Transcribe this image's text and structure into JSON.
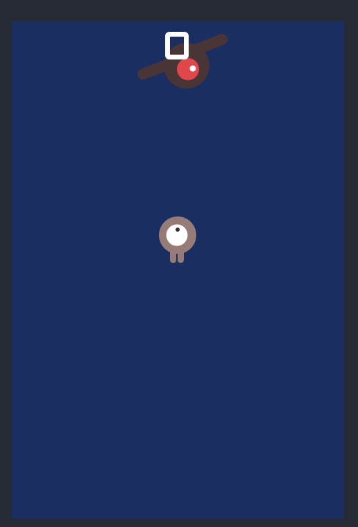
{
  "game": {
    "score": "0",
    "colors": {
      "frame": "#262a33",
      "field": "#1b2e61",
      "enemy_body": "#4a3536",
      "enemy_eye": "#e0474c",
      "player_body": "#957c79",
      "player_eye": "#ffffff",
      "pupil": "#3a2a2a",
      "score": "#ffffff"
    },
    "icons": {
      "enemy": "winged-red-eye-enemy-icon",
      "player": "one-eyed-creature-player-icon"
    }
  }
}
